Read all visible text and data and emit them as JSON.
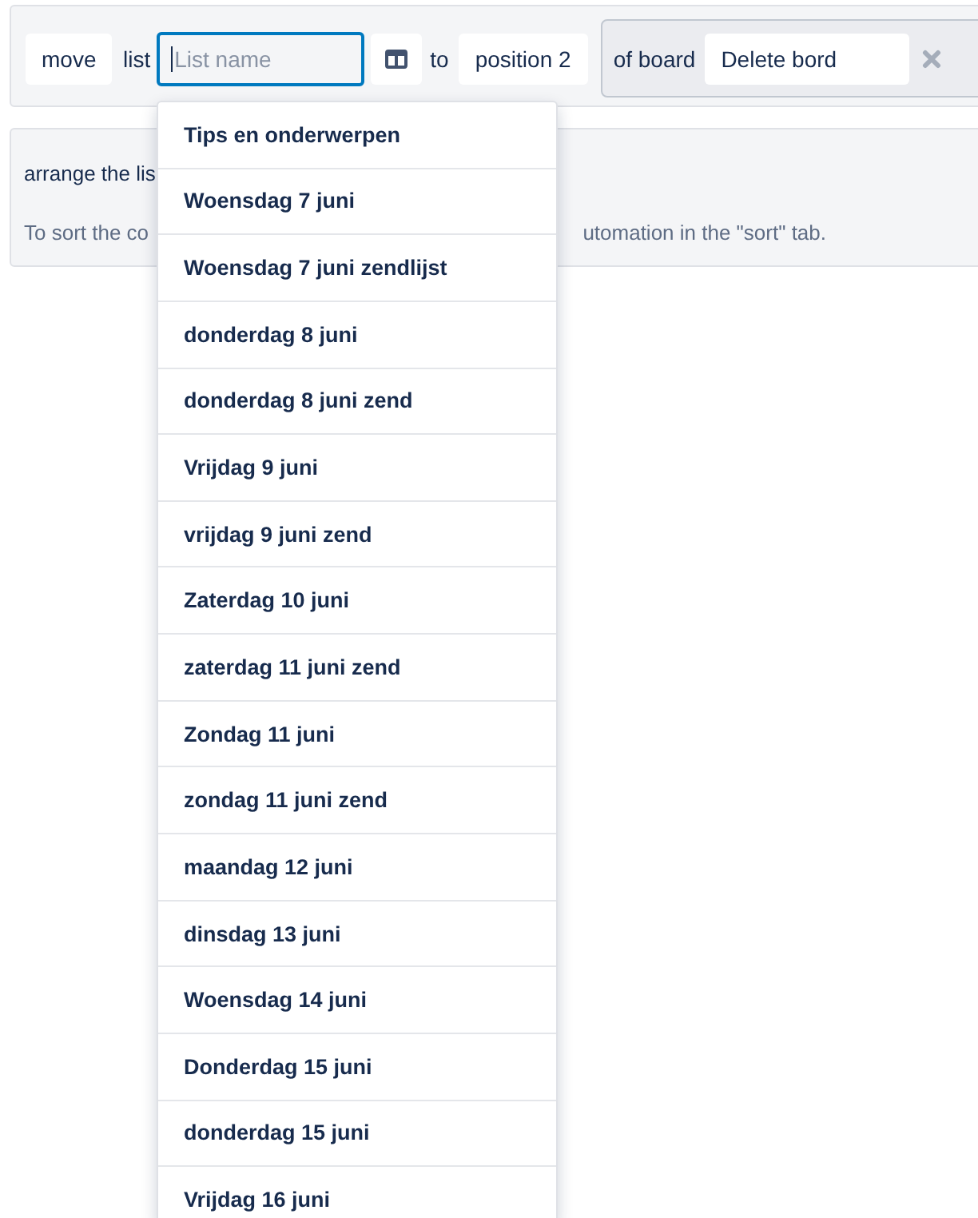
{
  "move_panel": {
    "move_button": "move",
    "list_label": "list",
    "list_field": {
      "placeholder": "List name",
      "focused": true
    },
    "to_label": "to",
    "position_select": "position 2",
    "board_group": {
      "label": "of board",
      "board_field": {
        "value": "Delete bord"
      }
    }
  },
  "info_panel": {
    "line_1": "arrange the lis",
    "line_2_left": "To sort the co",
    "line_2_right": "utomation in the \"sort\" tab."
  },
  "list_dropdown": {
    "items": [
      "Tips en onderwerpen",
      "Woensdag 7 juni",
      "Woensdag 7 juni zendlijst",
      "donderdag 8 juni",
      "donderdag 8 juni zend",
      "Vrijdag 9 juni",
      "vrijdag 9 juni zend",
      "Zaterdag 10 juni",
      "zaterdag 11 juni zend",
      "Zondag 11 juni",
      "zondag 11 juni zend",
      "maandag 12 juni",
      "dinsdag 13 juni",
      "Woensdag 14 juni",
      "Donderdag 15 juni",
      "donderdag 15 juni",
      "Vrijdag 16 juni"
    ]
  }
}
